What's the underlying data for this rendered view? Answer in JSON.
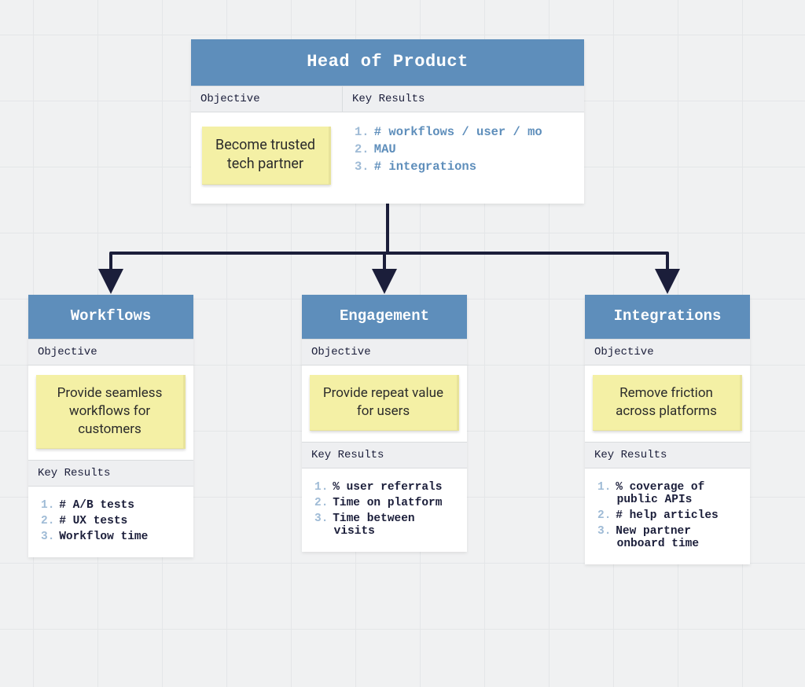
{
  "labels": {
    "objective": "Objective",
    "key_results": "Key Results"
  },
  "top": {
    "title": "Head of Product",
    "objective": "Become trusted tech partner",
    "key_results": [
      "# workflows / user / mo",
      "MAU",
      "# integrations"
    ]
  },
  "children": [
    {
      "title": "Workflows",
      "objective": "Provide seamless workflows for customers",
      "key_results": [
        "# A/B tests",
        "# UX tests",
        "Workflow time"
      ]
    },
    {
      "title": "Engagement",
      "objective": "Provide repeat value for users",
      "key_results": [
        "% user referrals",
        "Time on platform",
        "Time between visits"
      ]
    },
    {
      "title": "Integrations",
      "objective": "Remove friction across platforms",
      "key_results": [
        "% coverage of public APIs",
        "# help articles",
        "New partner onboard time"
      ]
    }
  ]
}
